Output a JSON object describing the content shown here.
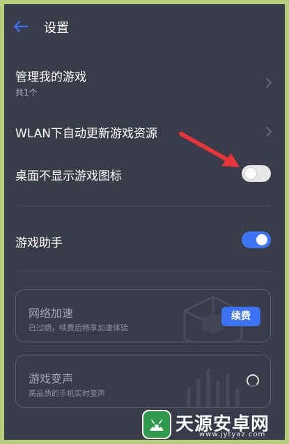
{
  "header": {
    "title": "设置"
  },
  "settings": {
    "manage_games": {
      "title": "管理我的游戏",
      "subtitle": "共1个"
    },
    "wlan_update": {
      "title": "WLAN下自动更新游戏资源"
    },
    "hide_desktop_icon": {
      "title": "桌面不显示游戏图标",
      "enabled": false
    },
    "game_assistant": {
      "title": "游戏助手",
      "enabled": true
    }
  },
  "cards": {
    "network_boost": {
      "title": "网络加速",
      "subtitle": "已过期，续费后畅享加速体验",
      "button_label": "续费"
    },
    "voice_changer": {
      "title": "游戏变声",
      "subtitle": "高品质的手机实时变声"
    }
  },
  "watermark": {
    "name": "天源安卓网",
    "url": "www.jytyaz.com"
  },
  "colors": {
    "background": "#3a3c4a",
    "accent": "#3b73f4",
    "arrow": "#e8343a"
  }
}
